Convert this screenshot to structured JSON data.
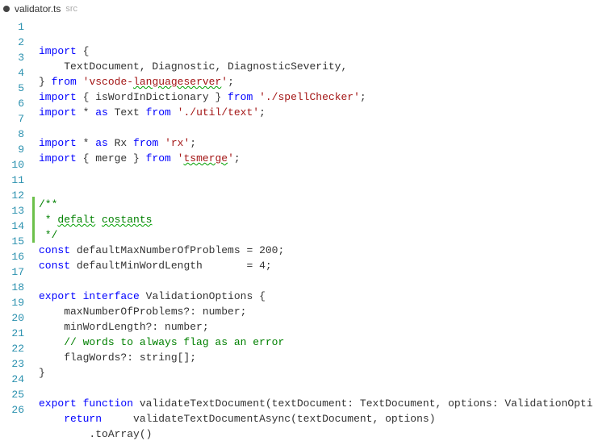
{
  "tab": {
    "is_dirty": true,
    "title": "validator.ts",
    "description": "src"
  },
  "editor": {
    "line_count": 26,
    "changed_lines": [
      11,
      12,
      13
    ],
    "squiggle_words": [
      "languageserver",
      "tsmerge",
      "defalt",
      "costants"
    ],
    "tokens": {
      "import": "import",
      "from": "from",
      "as": "as",
      "const": "const",
      "export": "export",
      "interface": "interface",
      "function": "function",
      "return": "return"
    },
    "code": {
      "l1": "import {",
      "l2_indent": "    ",
      "l2_names": "TextDocument, Diagnostic, DiagnosticSeverity,",
      "l3a": "} ",
      "l3_str": "'vscode-languageserver'",
      "l3b": ";",
      "l4a": " { isWordInDictionary } ",
      "l4_str": "'./spellChecker'",
      "l4b": ";",
      "l5a": " * ",
      "l5_as": "as",
      "l5_name": " Text ",
      "l5_str": "'./util/text'",
      "l5b": ";",
      "l7_name": " Rx ",
      "l7_str": "'rx'",
      "l7b": ";",
      "l8a": " { merge } ",
      "l8_str": "'tsmerge'",
      "l8b": ";",
      "doc_open": "/**",
      "doc_mid": " * defalt costants",
      "doc_close": " */",
      "l14_name": " defaultMaxNumberOfProblems = ",
      "l14_val": "200",
      "l14_end": ";",
      "l15_name": " defaultMinWordLength       = ",
      "l15_val": "4",
      "l15_end": ";",
      "l17_name": " ValidationOptions {",
      "l18": "    maxNumberOfProblems?: number;",
      "l19": "    minWordLength?: number;",
      "l20_cmt": "    // words to always flag as an error",
      "l21": "    flagWords?: string[];",
      "l22": "}",
      "l24_sig": " validateTextDocument(textDocument: TextDocument, options: ValidationOpti",
      "l25": "     validateTextDocumentAsync(textDocument, options)",
      "l26": "        .toArray()"
    }
  }
}
